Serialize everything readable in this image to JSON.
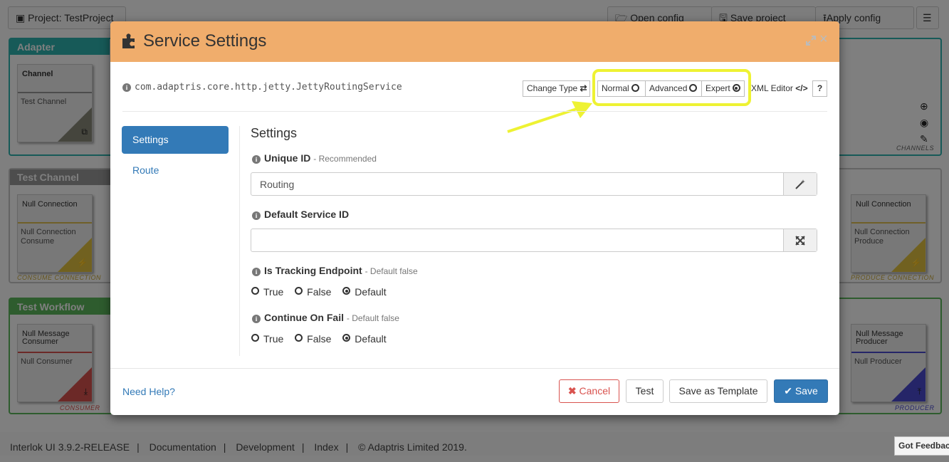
{
  "background": {
    "project_label": "Project: TestProject",
    "toolbar": {
      "open_config": "Open config",
      "save_project": "Save project",
      "apply_config": "Apply config"
    },
    "adapter_panel_title": "Adapter",
    "channel_card": {
      "title": "Channel",
      "subtitle": "Test Channel"
    },
    "channels_caption": "CHANNELS",
    "test_channel_panel_title": "Test Channel",
    "consume_card": {
      "title": "Null Connection",
      "subtitle": "Null Connection Consume",
      "caption": "CONSUME CONNECTION"
    },
    "produce_card": {
      "title": "Null Connection",
      "subtitle": "Null Connection Produce",
      "caption": "PRODUCE CONNECTION"
    },
    "workflow_panel_title": "Test Workflow",
    "consumer_card": {
      "title": "Null Message Consumer",
      "subtitle": "Null Consumer",
      "caption": "CONSUMER"
    },
    "producer_card": {
      "title": "Null Message Producer",
      "subtitle": "Null Producer",
      "caption": "PRODUCER"
    },
    "footer": {
      "version": "Interlok UI  3.9.2-RELEASE",
      "links": [
        "Documentation",
        "Development",
        "Index"
      ],
      "copyright": "© Adaptris Limited 2019."
    },
    "feedback": "Got Feedback"
  },
  "modal": {
    "title": "Service Settings",
    "class_name": "com.adaptris.core.http.jetty.JettyRoutingService",
    "toolbar": {
      "change_type": "Change Type",
      "modes": [
        {
          "label": "Normal",
          "selected": false
        },
        {
          "label": "Advanced",
          "selected": false
        },
        {
          "label": "Expert",
          "selected": true
        }
      ],
      "xml_editor": "XML Editor",
      "help": "?"
    },
    "nav": {
      "active": "Settings",
      "items": [
        "Route"
      ]
    },
    "section_title": "Settings",
    "fields": {
      "unique_id": {
        "label": "Unique ID",
        "hint": "- Recommended",
        "value": "Routing"
      },
      "default_service_id": {
        "label": "Default Service ID",
        "value": ""
      },
      "is_tracking_endpoint": {
        "label": "Is Tracking Endpoint",
        "hint": "- Default false",
        "options": [
          "True",
          "False",
          "Default"
        ],
        "selected": "Default"
      },
      "continue_on_fail": {
        "label": "Continue On Fail",
        "hint": "- Default false",
        "options": [
          "True",
          "False",
          "Default"
        ],
        "selected": "Default"
      }
    },
    "footer": {
      "need_help": "Need Help?",
      "cancel": "Cancel",
      "test": "Test",
      "save_as_template": "Save as Template",
      "save": "Save"
    }
  },
  "colors": {
    "header": "#f0ad6c",
    "primary": "#337ab7",
    "danger": "#d9534f",
    "highlight": "#eef233"
  }
}
